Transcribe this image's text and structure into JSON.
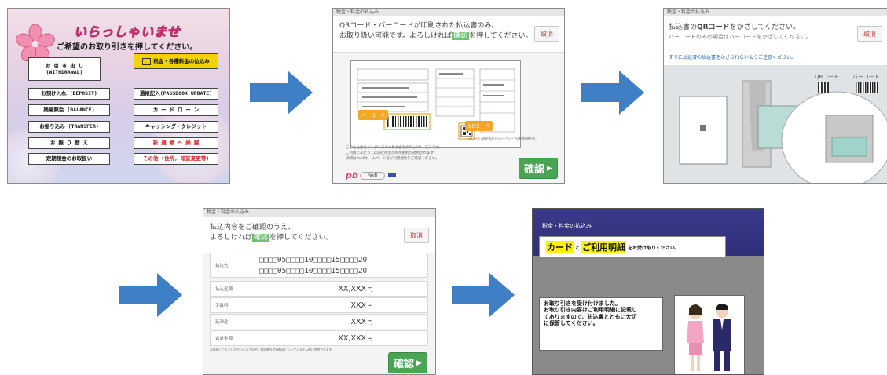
{
  "panel1": {
    "welcome": "いらっしゃいませ",
    "subtitle": "ご希望のお取り引きを押してください。",
    "buttons": [
      {
        "l1": "お 引 き 出 し",
        "l2": "(WITHDRAWAL)"
      },
      {
        "l1": "税金・各種料金の払込み",
        "l2": ""
      },
      {
        "l1": "お預け入れ (DEPOSIT)",
        "l2": ""
      },
      {
        "l1": "通帳記入(PASSBOOK UPDATE)",
        "l2": ""
      },
      {
        "l1": "残高照会 (BALANCE)",
        "l2": ""
      },
      {
        "l1": "カ ー ド ロ ー ン",
        "l2": ""
      },
      {
        "l1": "お振り込み (TRANSFER)",
        "l2": ""
      },
      {
        "l1": "キャッシング・クレジット",
        "l2": ""
      },
      {
        "l1": "お 振 り 替 え",
        "l2": ""
      },
      {
        "l1": "新 通 帳 へ 繰 越",
        "l2": ""
      },
      {
        "l1": "定期預金のお取扱い",
        "l2": ""
      },
      {
        "l1": "その他 (住所, 暗証変更等)",
        "l2": ""
      }
    ]
  },
  "panel2": {
    "topbar": "税金・料金の払込み",
    "msg1": "QRコード・バーコードが印刷された払込書のみ、",
    "msg2a": "お取り扱い可能です。よろしければ",
    "msg2b": "確認",
    "msg2c": "を押してください。",
    "cancel": "取消",
    "barcode_label": "バーコード",
    "qr_label": "QRコード",
    "qr_note": "QRコードは株式会社デンソーウェーブの登録商標です。",
    "note1": "この払込はビリングシステム株式会社のPayBサービスです。",
    "note2": "ご利用にあたっては同社所定の利用規約が適用されます。",
    "note3": "詳細はPayBホームページ及び利用規約をご確認ください。",
    "payb_logo": "pb",
    "payb_text": "PayB",
    "confirm": "確認"
  },
  "panel3": {
    "topbar": "税金・料金の払込み",
    "msg1a": "払込書の",
    "msg1b": "QRコード",
    "msg1c": "をかざしてください。",
    "msg2": "バーコードのみの場合はバーコードをかざしてください。",
    "cancel": "取消",
    "warning": "すでに払込済の払込書をかざされないようご注意ください。",
    "qr_label": "QRコード",
    "barcode_label": "バーコード"
  },
  "panel4": {
    "topbar": "税金・料金の払込み",
    "msg1": "払込内容をご確認のうえ、",
    "msg2a": "よろしければ",
    "msg2b": "確認",
    "msg2c": "を押してください。",
    "cancel": "取消",
    "payee_label": "払込先",
    "payee_line1": "□□□□05□□□□10□□□□15□□□□20",
    "payee_line2": "□□□□05□□□□10□□□□15□□□□20",
    "rows": [
      {
        "label": "払込金額",
        "value": "XX,XXX",
        "unit": "円"
      },
      {
        "label": "手数料",
        "value": "XXX",
        "unit": "円"
      },
      {
        "label": "延滞金",
        "value": "XXX",
        "unit": "円"
      },
      {
        "label": "合計金額",
        "value": "XX,XXX",
        "unit": "円"
      }
    ],
    "footnote": "お客様にご入力いただいたカナ氏名・電話番号の情報はビリングシステム株に提供されます。",
    "confirm": "確認"
  },
  "panel5": {
    "tag": "税金・料金の払込み",
    "card": "カード",
    "to": "と",
    "detail": "ご利用明細",
    "suffix": "をお受け取りください。",
    "info1": "お取り引きを受け付けました。",
    "info2": "お取り引き内容はご利用明細に記載し",
    "info3": "てありますので、払込書とともに大切",
    "info4": "に保管してください。"
  },
  "colors": {
    "arrow": "#3f7fc6",
    "confirm": "#49a553",
    "highlight": "#fff200",
    "gold": "#f2d300",
    "alert_red": "#d61a1a"
  }
}
